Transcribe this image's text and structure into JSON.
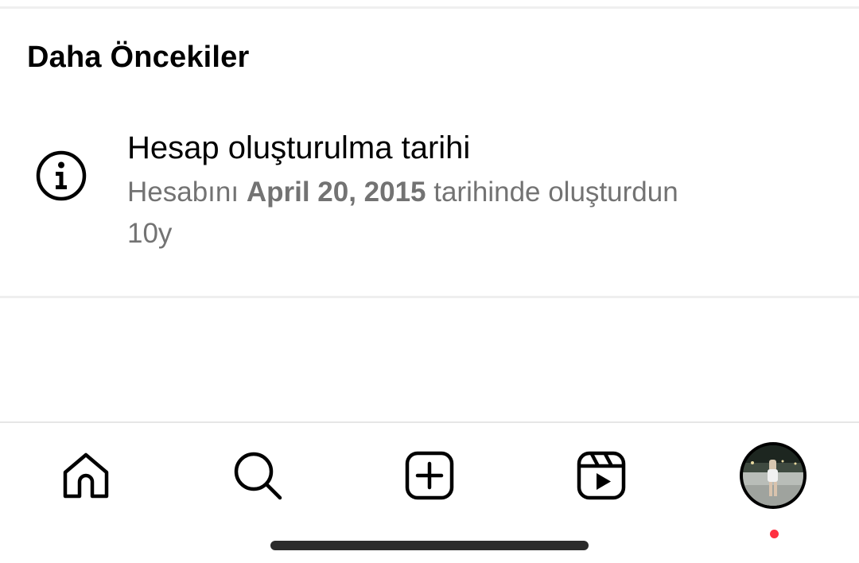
{
  "section": {
    "title": "Daha Öncekiler"
  },
  "activity_item": {
    "icon": "info-icon",
    "title": "Hesap oluşturulma tarihi",
    "desc_prefix": "Hesabını ",
    "desc_date": "April 20, 2015",
    "desc_suffix": " tarihinde oluşturdun",
    "time_ago": "10y"
  },
  "bottom_nav": {
    "items": [
      {
        "name": "home",
        "icon": "home-icon"
      },
      {
        "name": "search",
        "icon": "search-icon"
      },
      {
        "name": "create",
        "icon": "plus-square-icon"
      },
      {
        "name": "reels",
        "icon": "reels-icon"
      },
      {
        "name": "profile",
        "icon": "avatar"
      }
    ],
    "notification_dot_color": "#ff3040"
  },
  "colors": {
    "text_primary": "#000000",
    "text_secondary": "#737373",
    "divider": "#efefef",
    "background": "#ffffff"
  }
}
